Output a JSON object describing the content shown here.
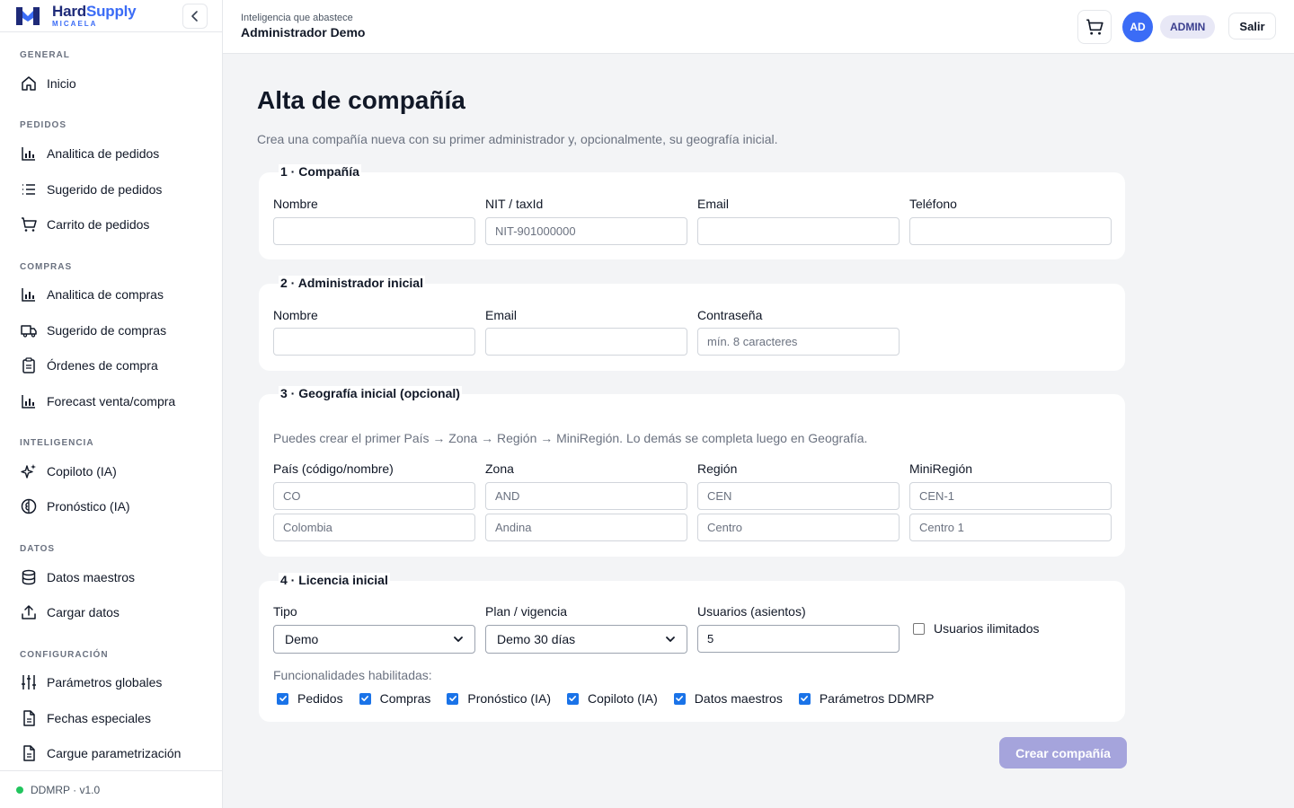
{
  "brand": {
    "name_part1": "Hard",
    "name_part2": "Supply",
    "subtitle": "MICAELA"
  },
  "colors": {
    "brand_dark": "#1e2a78",
    "brand_accent": "#3b6cf6",
    "checkbox": "#1a73e8",
    "submit_disabled": "#a5a4dc",
    "status_ok": "#22c55e"
  },
  "sidebar": {
    "sections": [
      {
        "label": "GENERAL",
        "items": [
          {
            "label": "Inicio",
            "icon": "home-icon"
          }
        ]
      },
      {
        "label": "PEDIDOS",
        "items": [
          {
            "label": "Analitica de pedidos",
            "icon": "bar-chart-icon"
          },
          {
            "label": "Sugerido de pedidos",
            "icon": "list-icon"
          },
          {
            "label": "Carrito de pedidos",
            "icon": "cart-icon"
          }
        ]
      },
      {
        "label": "COMPRAS",
        "items": [
          {
            "label": "Analitica de compras",
            "icon": "bar-chart-icon"
          },
          {
            "label": "Sugerido de compras",
            "icon": "truck-icon"
          },
          {
            "label": "Órdenes de compra",
            "icon": "clipboard-icon"
          },
          {
            "label": "Forecast venta/compra",
            "icon": "bar-chart-icon"
          }
        ]
      },
      {
        "label": "INTELIGENCIA",
        "items": [
          {
            "label": "Copiloto (IA)",
            "icon": "sparkles-icon"
          },
          {
            "label": "Pronóstico (IA)",
            "icon": "brain-icon"
          }
        ]
      },
      {
        "label": "DATOS",
        "items": [
          {
            "label": "Datos maestros",
            "icon": "database-icon"
          },
          {
            "label": "Cargar datos",
            "icon": "upload-icon"
          }
        ]
      },
      {
        "label": "CONFIGURACIÓN",
        "items": [
          {
            "label": "Parámetros globales",
            "icon": "sliders-icon"
          },
          {
            "label": "Fechas especiales",
            "icon": "file-icon"
          },
          {
            "label": "Cargue parametrización",
            "icon": "file-icon"
          }
        ]
      }
    ],
    "footer": "DDMRP · v1.0"
  },
  "header": {
    "subtitle": "Inteligencia que abastece",
    "title": "Administrador Demo",
    "avatar": "AD",
    "role": "ADMIN",
    "logout": "Salir"
  },
  "page": {
    "title": "Alta de compañía",
    "description": "Crea una compañía nueva con su primer administrador y, opcionalmente, su geografía inicial."
  },
  "company": {
    "title": "1 · Compañía",
    "name_label": "Nombre",
    "taxid_label": "NIT / taxId",
    "taxid_placeholder": "NIT-901000000",
    "email_label": "Email",
    "phone_label": "Teléfono"
  },
  "admin": {
    "title": "2 · Administrador inicial",
    "name_label": "Nombre",
    "email_label": "Email",
    "password_label": "Contraseña",
    "password_placeholder": "mín. 8 caracteres"
  },
  "geo": {
    "title": "3 · Geografía inicial (opcional)",
    "hint": "Puedes crear el primer País → Zona → Región → MiniRegión. Lo demás se completa luego en Geografía.",
    "country_label": "País (código/nombre)",
    "zone_label": "Zona",
    "region_label": "Región",
    "miniregion_label": "MiniRegión",
    "country_code_ph": "CO",
    "country_name_ph": "Colombia",
    "zone_code_ph": "AND",
    "zone_name_ph": "Andina",
    "region_code_ph": "CEN",
    "region_name_ph": "Centro",
    "miniregion_code_ph": "CEN-1",
    "miniregion_name_ph": "Centro 1"
  },
  "license": {
    "title": "4 · Licencia inicial",
    "type_label": "Tipo",
    "type_value": "Demo",
    "plan_label": "Plan / vigencia",
    "plan_value": "Demo 30 días",
    "seats_label": "Usuarios (asientos)",
    "seats_value": "5",
    "unlimited_label": "Usuarios ilimitados",
    "unlimited_checked": false,
    "features_label": "Funcionalidades habilitadas:",
    "features": [
      {
        "label": "Pedidos",
        "checked": true
      },
      {
        "label": "Compras",
        "checked": true
      },
      {
        "label": "Pronóstico (IA)",
        "checked": true
      },
      {
        "label": "Copiloto (IA)",
        "checked": true
      },
      {
        "label": "Datos maestros",
        "checked": true
      },
      {
        "label": "Parámetros DDMRP",
        "checked": true
      }
    ]
  },
  "submit": "Crear compañía"
}
